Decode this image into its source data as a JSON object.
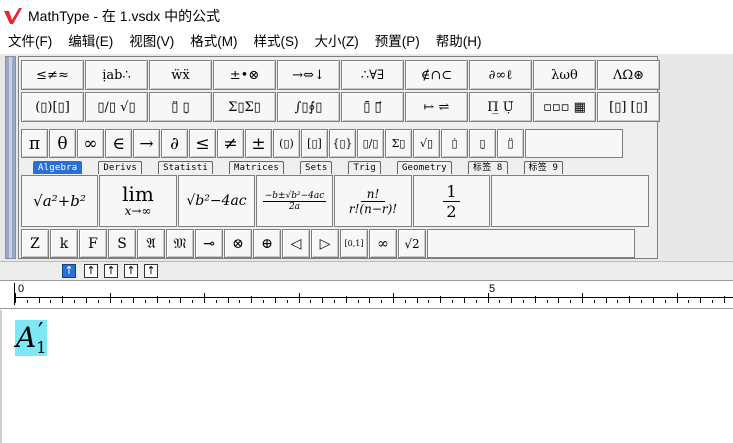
{
  "window": {
    "title": "MathType - 在 1.vsdx 中的公式",
    "accent": "#e8262c"
  },
  "menu": [
    "文件(F)",
    "编辑(E)",
    "视图(V)",
    "格式(M)",
    "样式(S)",
    "大小(Z)",
    "预置(P)",
    "帮助(H)"
  ],
  "palette_row1": [
    "≤≠≈",
    "ịab∴",
    "ẅẍ",
    "±•⊗",
    "→⇔↓",
    "∴∀∃",
    "∉∩⊂",
    "∂∞ℓ",
    "λωθ",
    "ΛΩ⊛"
  ],
  "palette_row2": [
    "(▯)[▯]",
    "▯/▯ √▯",
    "▯̈ ▯̣",
    "Σ▯Σ▯",
    "∫▯∮▯",
    "▯̄ ▯⃗",
    "⥛ ⇌",
    "Π̲ Ụ̈",
    "▫▫▫ ▦",
    "[▯] [▯]"
  ],
  "symbols": [
    "π",
    "θ",
    "∞",
    "∈",
    "→",
    "∂",
    "≤",
    "≠",
    "±",
    "(▯)",
    "[▯]",
    "{▯}",
    "▯/▯",
    "Σ▯",
    "√▯",
    "▯̇",
    "▯̣",
    "▯̈"
  ],
  "tabs": [
    "Algebra",
    "Derivs",
    "Statisti",
    "Matrices",
    "Sets",
    "Trig",
    "Geometry",
    "标签 8",
    "标签 9"
  ],
  "templates": [
    {
      "id": "pythag",
      "text": "√a²+b²"
    },
    {
      "id": "limit",
      "top": "lim",
      "bottom": "x→∞"
    },
    {
      "id": "disc",
      "text": "√b²−4ac"
    },
    {
      "id": "quad",
      "top": "−b±√b²−4ac",
      "bottom": "2a"
    },
    {
      "id": "comb",
      "top": "n!",
      "bottom": "r!(n−r)!"
    },
    {
      "id": "half",
      "top": "1",
      "bottom": "2"
    }
  ],
  "small_row": [
    "Z",
    "k",
    "F",
    "S",
    "𝔄",
    "𝔐",
    "⊸",
    "⊗",
    "⊕",
    "◁",
    "▷",
    "[0,1]",
    "∞",
    "√2"
  ],
  "size_buttons": [
    "↑",
    "↑",
    "↑",
    "↑",
    "↑"
  ],
  "ruler": {
    "labels": [
      "0",
      "5"
    ]
  },
  "equation": {
    "base": "A",
    "sub": "1",
    "prime": "′",
    "highlight": "#7fe6f5"
  }
}
